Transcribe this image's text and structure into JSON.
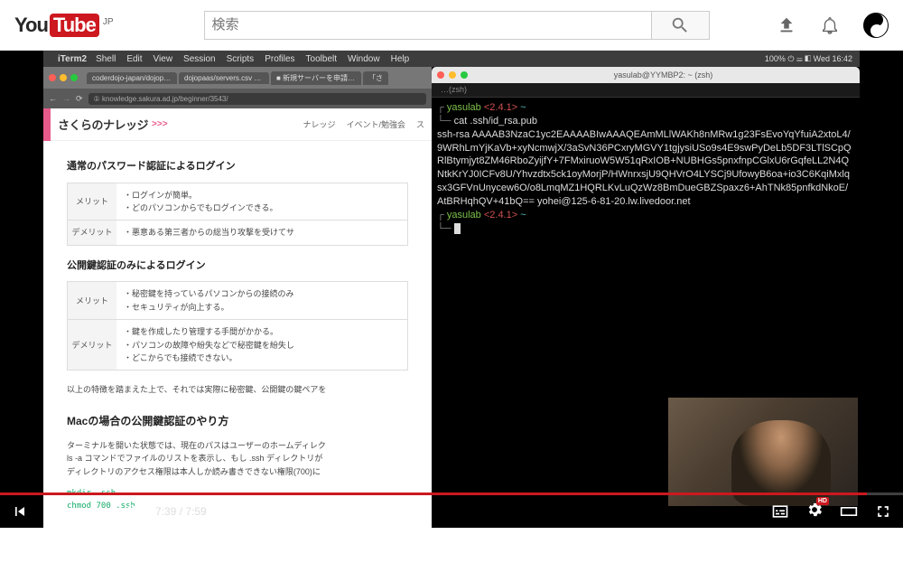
{
  "header": {
    "logo_you": "You",
    "logo_tube": "Tube",
    "region": "JP",
    "search_placeholder": "検索"
  },
  "mac": {
    "app": "iTerm2",
    "menus": [
      "Shell",
      "Edit",
      "View",
      "Session",
      "Scripts",
      "Profiles",
      "Toolbelt",
      "Window",
      "Help"
    ],
    "right": "100% ⏻ ☰ ◧  Wed 16:42"
  },
  "browser": {
    "tabs": [
      "coderdojo-japan/dojopaas:",
      "dojopaas/servers.csv at mast…",
      "■ 新規サーバーを申請するため…",
      "「さ"
    ],
    "url": "① knowledge.sakura.ad.jp/beginner/3543/",
    "site_logo": "さくらのナレッジ",
    "chev": ">>>",
    "nav": [
      "ナレッジ",
      "イベント/勉強会",
      "ス"
    ],
    "sec1_title": "通常のパスワード認証によるログイン",
    "t1r1h": "メリット",
    "t1r1c": "・ログインが簡単。\n・どのパソコンからでもログインできる。",
    "t1r2h": "デメリット",
    "t1r2c": "・悪意ある第三者からの総当り攻撃を受けてサ",
    "sec2_title": "公開鍵認証のみによるログイン",
    "t2r1h": "メリット",
    "t2r1c": "・秘密鍵を持っているパソコンからの接続のみ\n・セキュリティが向上する。",
    "t2r2h": "デメリット",
    "t2r2c": "・鍵を作成したり管理する手間がかかる。\n・パソコンの故障や紛失などで秘密鍵を紛失し\n・どこからでも接続できない。",
    "p1": "以上の特徴を踏まえた上で、それでは実際に秘密鍵、公開鍵の鍵ペアを",
    "sec3_title": "Macの場合の公開鍵認証のやり方",
    "p2a": "ターミナルを開いた状態では、現在のパスはユーザーのホームディレク",
    "p2b": "ls -a コマンドでファイルのリストを表示し、もし .ssh ディレクトリが",
    "p2c": "ディレクトリのアクセス権限は本人しか読み書きできない権限(700)に",
    "code1": "mkdir .ssh",
    "code2": "chmod 700 .ssh"
  },
  "terminal": {
    "title": "yasulab@YYMBP2: ~ (zsh)",
    "tab": "…(zsh)",
    "user": "yasulab",
    "ver": "<2.4.1>",
    "tilde": "~",
    "cmd": "cat .ssh/id_rsa.pub",
    "key": "ssh-rsa AAAAB3NzaC1yc2EAAAABIwAAAQEAmMLlWAKh8nMRw1g23FsEvoYqYfuiA2xtoL4/9WRhLmYjKaVb+xyNcmwjX/3aSvN36PCxryMGVY1tgjysiUSo9s4E9swPyDeLb5DF3LTlSCpQRlBtymjyt8ZM46RboZyijfY+7FMxiruoW5W51qRxIOB+NUBHGs5pnxfnpCGlxU6rGqfeLL2N4QNtkKrYJ0ICFv8U/Yhvzdtx5ck1oyMorjP/HWnrxsjU9QHVrO4LYSCj9UfowyB6oa+io3C6KqiMxlqsx3GFVnUnycew6O/o8LmqMZ1HQRLKvLuQzWz8BmDueGBZSpaxz6+AhTNk85pnfkdNkoE/AtBRHqhQV+41bQ== yohei@125-6-81-20.lw.livedoor.net"
  },
  "player": {
    "current": "7:39",
    "total": "7:59",
    "hd": "HD"
  }
}
